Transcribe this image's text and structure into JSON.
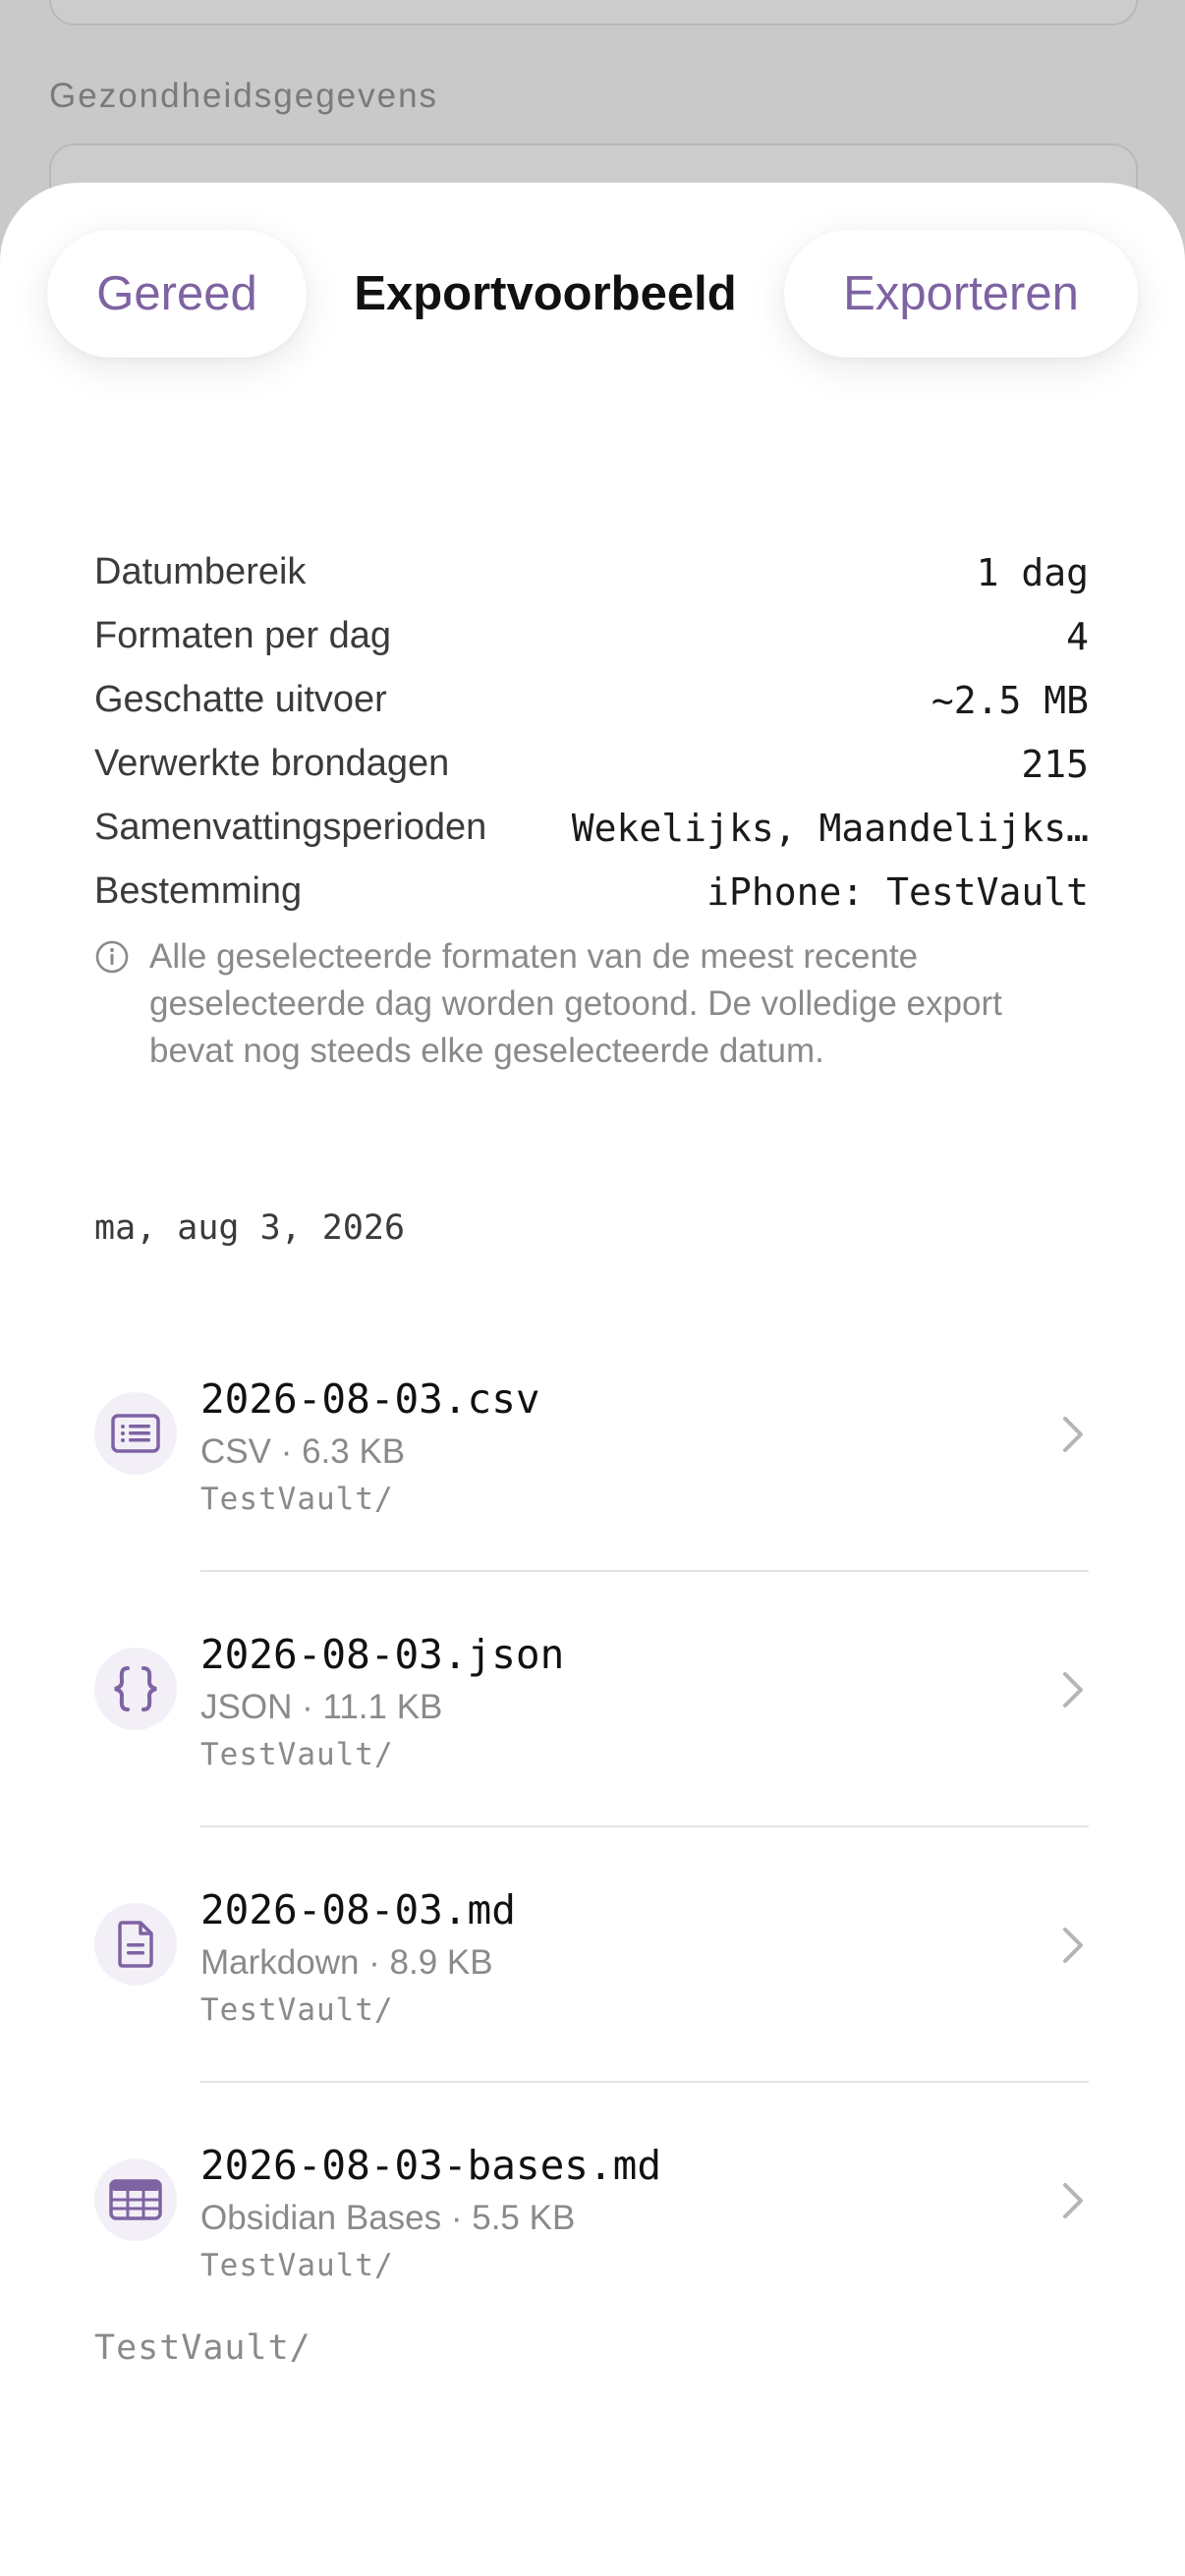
{
  "background": {
    "section_label": "Gezondheidsgegevens"
  },
  "nav": {
    "done_label": "Gereed",
    "title": "Exportvoorbeeld",
    "export_label": "Exporteren"
  },
  "summary": {
    "rows": [
      {
        "label": "Datumbereik",
        "value": "1 dag"
      },
      {
        "label": "Formaten per dag",
        "value": "4"
      },
      {
        "label": "Geschatte uitvoer",
        "value": "~2.5 MB"
      },
      {
        "label": "Verwerkte brondagen",
        "value": "215"
      },
      {
        "label": "Samenvattingsperioden",
        "value": "Wekelijks, Maandelijks…"
      },
      {
        "label": "Bestemming",
        "value": "iPhone: TestVault"
      }
    ],
    "info_text": "Alle geselecteerde formaten van de meest recente geselecteerde dag worden getoond. De volledige export bevat nog steeds elke geselecteerde datum."
  },
  "date_header": "ma, aug 3, 2026",
  "files": [
    {
      "name": "2026-08-03.csv",
      "meta": "CSV · 6.3 KB",
      "path": "TestVault/",
      "icon": "list-icon"
    },
    {
      "name": "2026-08-03.json",
      "meta": "JSON · 11.1 KB",
      "path": "TestVault/",
      "icon": "braces-icon"
    },
    {
      "name": "2026-08-03.md",
      "meta": "Markdown · 8.9 KB",
      "path": "TestVault/",
      "icon": "document-icon"
    },
    {
      "name": "2026-08-03-bases.md",
      "meta": "Obsidian Bases · 5.5 KB",
      "path": "TestVault/",
      "icon": "table-icon"
    }
  ],
  "footer_path": "TestVault/",
  "colors": {
    "accent": "#7e63a3",
    "icon_bg": "#f3eff7",
    "dimmed_background": "#c9c9c9"
  }
}
